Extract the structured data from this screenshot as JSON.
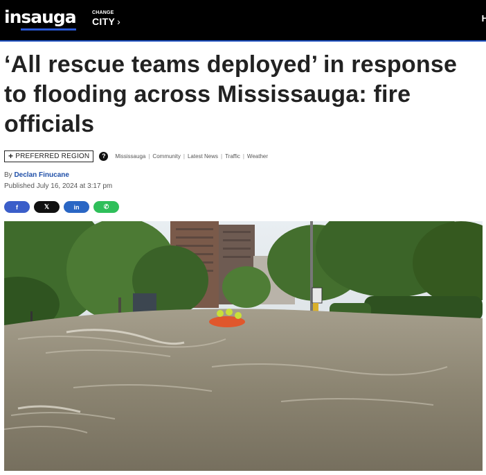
{
  "header": {
    "logo_text": "insauga",
    "change_city_small": "CHANGE",
    "change_city_big": "CITY",
    "chevron": "›",
    "menu_partial": "H"
  },
  "colors": {
    "header_bg": "#000000",
    "accent_blue": "#2a58d6",
    "author_link": "#1f4fa8",
    "facebook": "#3b5ec9",
    "x": "#111111",
    "linkedin": "#2a66c4",
    "whatsapp": "#2fbf5a"
  },
  "article": {
    "headline": "‘All rescue teams deployed’ in response to flooding across Mississauga: fire officials",
    "preferred_region": "PREFERRED REGION",
    "plus": "+",
    "help": "?",
    "tags": [
      "Mississauga",
      "Community",
      "Latest News",
      "Traffic",
      "Weather"
    ],
    "by": "By",
    "author": "Declan Finucane",
    "published": "Published July 16, 2024 at 3:17 pm"
  },
  "share": {
    "facebook": "f",
    "x": "𝕏",
    "linkedin": "in",
    "whatsapp": "✆"
  },
  "icons": [
    "help-icon",
    "facebook-icon",
    "x-icon",
    "linkedin-icon",
    "whatsapp-icon",
    "chevron-right-icon"
  ]
}
